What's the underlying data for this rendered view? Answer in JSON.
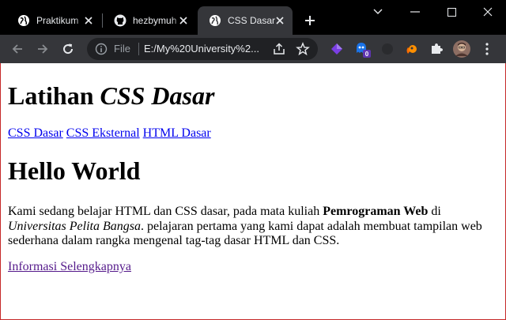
{
  "browser": {
    "tabs": [
      {
        "label": "Praktikum",
        "icon": "globe-icon",
        "active": false
      },
      {
        "label": "hezbymuh",
        "icon": "github-icon",
        "active": false
      },
      {
        "label": "CSS Dasar",
        "icon": "globe-icon",
        "active": true
      }
    ],
    "address": {
      "scheme_label": "File",
      "url": "E:/My%20University%2..."
    },
    "extensions": [
      "purple-gem-icon",
      "ghost-badge-icon",
      "dark-extension-icon",
      "orange-extension-icon",
      "puzzle-icon",
      "profile-avatar-icon",
      "kebab-menu-icon"
    ],
    "extension_badge": "0",
    "accent_colors": {
      "tabstrip": "#000000",
      "toolbar": "#35363a",
      "omnibox": "#202124",
      "page_border": "#c62828"
    }
  },
  "page": {
    "heading_plain": "Latihan ",
    "heading_italic": "CSS Dasar",
    "nav_links": [
      "CSS Dasar",
      "CSS Eksternal",
      "HTML Dasar"
    ],
    "subheading": "Hello World",
    "paragraph": {
      "part1": "Kami sedang belajar HTML dan CSS dasar, pada mata kuliah ",
      "bold": "Pemrograman Web",
      "part2": " di ",
      "italic": "Universitas Pelita Bangsa",
      "part3": ". pelajaran pertama yang kami dapat adalah membuat tampilan web sederhana dalam rangka mengenal tag-tag dasar HTML dan CSS."
    },
    "more_link": "Informasi Selengkapnya",
    "link_colors": {
      "unvisited": "#0000ee",
      "visited": "#551a8b"
    }
  }
}
